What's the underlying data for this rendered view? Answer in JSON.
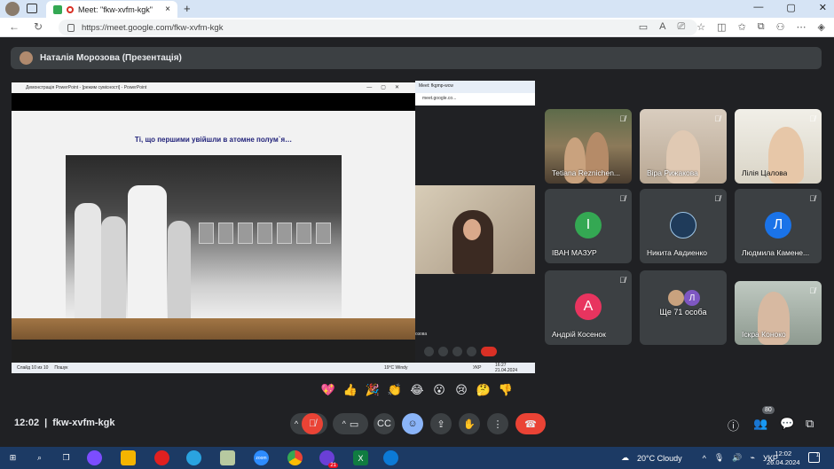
{
  "browser": {
    "tab_title": "Meet: \"fkw-xvfm-kgk\"",
    "tab_close": "×",
    "new_tab": "+",
    "url": "https://meet.google.com/fkw-xvfm-kgk",
    "window_controls": [
      "—",
      "▢",
      "✕"
    ]
  },
  "meet": {
    "presenter_label": "Наталія Морозова (Презентація)",
    "meeting_time": "12:02",
    "meeting_code": "fkw-xvfm-kgk",
    "people_count": "80"
  },
  "shared_screen": {
    "ppt_window_title": "Демонстрація PowerPoint - [режим сумісності] - PowerPoint",
    "slide_title": "Ті, що першими увійшли в атомне полум`я…",
    "chrome_tabs": "Meet: fkgmp-wcw",
    "chrome_url": "meet.google.co...",
    "taskbar_search": "Пошук",
    "taskbar_weather": "19°C  Windy",
    "taskbar_lang": "УКР",
    "taskbar_time": "16:27",
    "taskbar_date": "21.04.2024",
    "slide_status": "Слайд 10 из 10",
    "name_fragment": "озова"
  },
  "participants": [
    {
      "name": "Tetiana Reznichen...",
      "type": "video",
      "muted": true
    },
    {
      "name": "Віра Рижакова",
      "type": "video",
      "muted": true
    },
    {
      "name": "Лілія Цалова",
      "type": "video",
      "muted": true
    },
    {
      "name": "ІВАН МАЗУР",
      "type": "avatar",
      "initial": "І",
      "color": "#34a853",
      "muted": true
    },
    {
      "name": "Никита Авдиенко",
      "type": "avatar",
      "initial": "",
      "color": "#1f3b5a",
      "muted": true
    },
    {
      "name": "Людмила Камене...",
      "type": "avatar",
      "initial": "Л",
      "color": "#1a73e8",
      "muted": true
    },
    {
      "name": "Андрій Косенок",
      "type": "avatar",
      "initial": "А",
      "color": "#e8345f",
      "muted": true
    },
    {
      "name": "Ще 71 особа",
      "type": "more",
      "initial": "Л",
      "color": "#7e57c2"
    },
    {
      "name": "Іскра Коноко",
      "type": "video",
      "muted": true
    }
  ],
  "reactions": [
    "💖",
    "👍",
    "🎉",
    "👏",
    "😂",
    "😮",
    "😢",
    "🤔",
    "👎"
  ],
  "taskbar": {
    "weather": "20°C  Cloudy",
    "lang": "УКР",
    "time": "12:02",
    "date": "26.04.2024",
    "notif_count": "1",
    "telegram_badge": "21"
  },
  "colors": {
    "meet_bg": "#202124",
    "tile_bg": "#3c4043",
    "end_call": "#ea4335",
    "accent_blue": "#8ab4f8",
    "taskbar": "#1c3a64"
  }
}
